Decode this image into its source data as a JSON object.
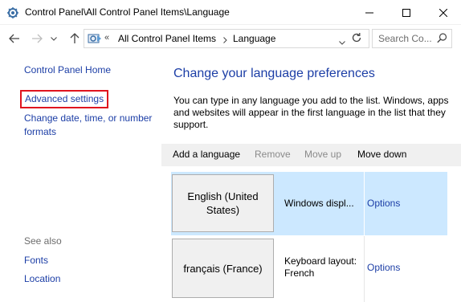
{
  "window": {
    "title": "Control Panel\\All Control Panel Items\\Language"
  },
  "address_bar": {
    "chevron": "«",
    "crumbs": [
      "All Control Panel Items",
      "Language"
    ],
    "search_placeholder": "Search Co..."
  },
  "left_pane": {
    "home": "Control Panel Home",
    "advanced": "Advanced settings",
    "date": "Change date, time, or number formats",
    "see_also": "See also",
    "fonts": "Fonts",
    "location": "Location"
  },
  "main": {
    "heading": "Change your language preferences",
    "description": "You can type in any language you add to the list. Windows, apps and websites will appear in the first language in the list that they support.",
    "toolbar": {
      "add": "Add a language",
      "remove": "Remove",
      "move_up": "Move up",
      "move_down": "Move down"
    },
    "languages": [
      {
        "name": "English (United States)",
        "info": "Windows displ...",
        "options": "Options",
        "selected": true
      },
      {
        "name": "français (France)",
        "info": "Keyboard layout: French",
        "options": "Options",
        "selected": false
      }
    ]
  },
  "icons": {
    "app": "control-panel-icon",
    "minimize": "minimize-icon",
    "maximize": "maximize-icon",
    "close": "close-icon",
    "back": "back-arrow-icon",
    "forward": "forward-arrow-icon",
    "recent": "chevron-down-icon",
    "up": "up-arrow-icon",
    "refresh": "refresh-icon",
    "search": "search-icon"
  },
  "colors": {
    "link": "#1c3ea6",
    "selected_row": "#cce8ff",
    "toolbar_bg": "#f0f0f0",
    "highlight_box": "#e0141e",
    "disabled_text": "#8a8a8a"
  }
}
